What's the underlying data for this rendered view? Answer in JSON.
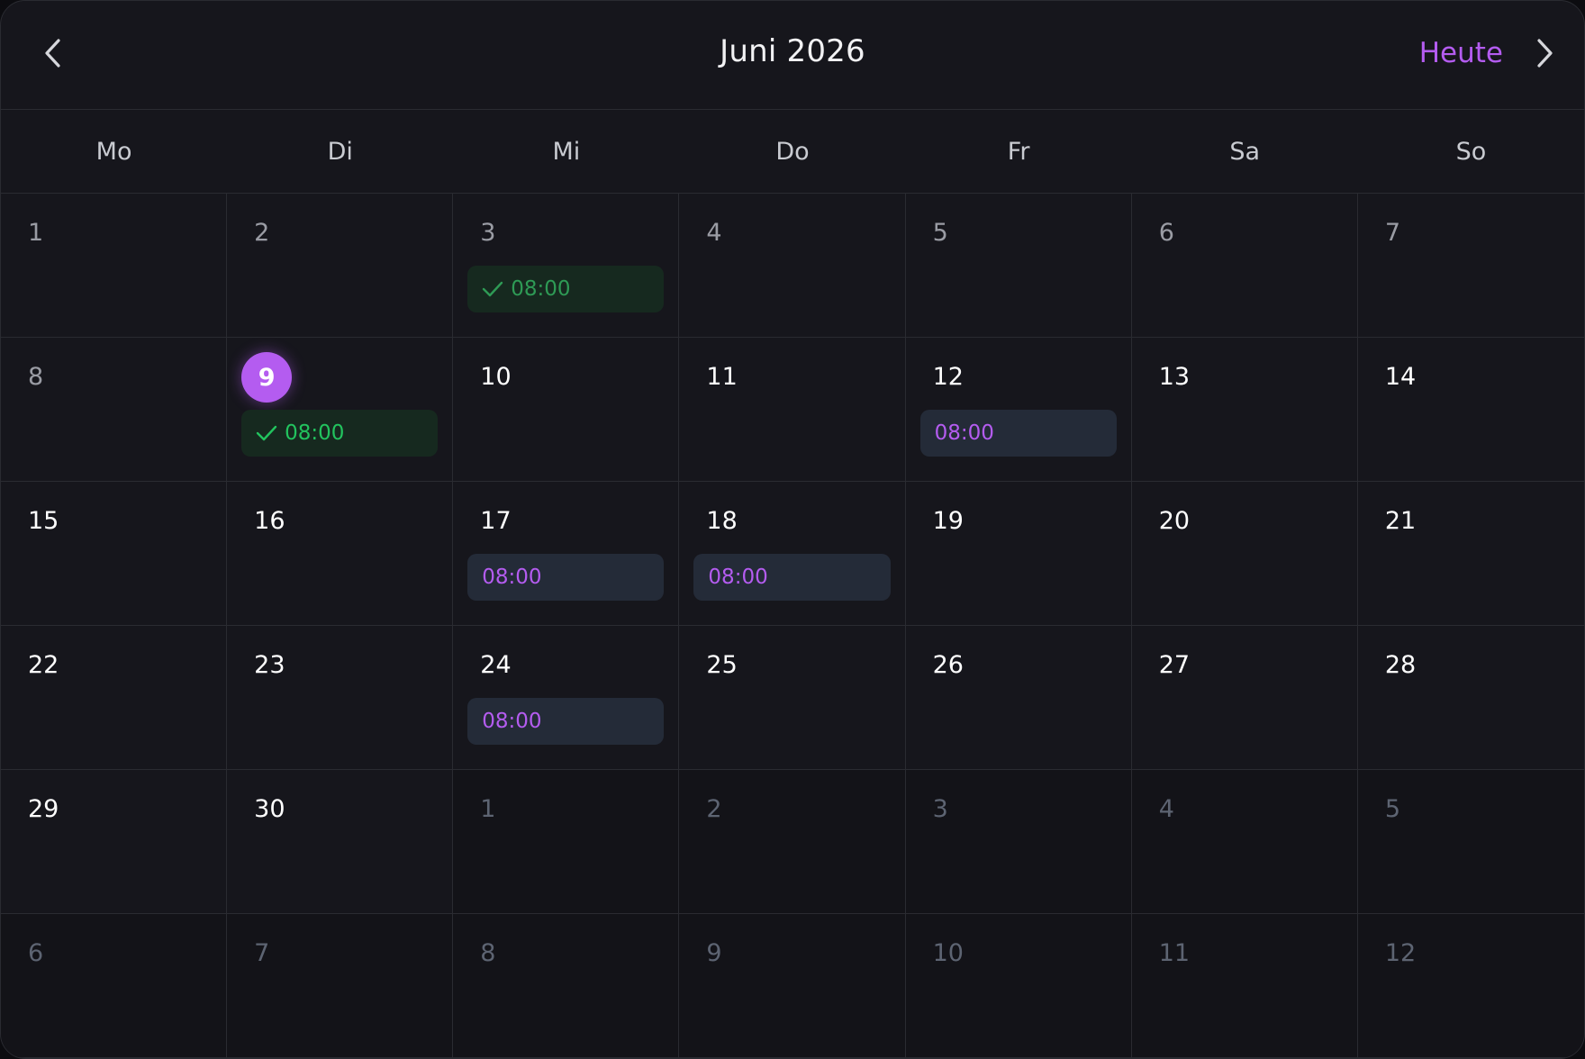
{
  "header": {
    "title": "Juni 2026",
    "today_label": "Heute",
    "prev_icon": "chevron-left-icon",
    "next_icon": "chevron-right-icon"
  },
  "weekdays": [
    "Mo",
    "Di",
    "Mi",
    "Do",
    "Fr",
    "Sa",
    "So"
  ],
  "colors": {
    "accent": "#b45cf0",
    "done": "#22c35e",
    "background": "#16161c"
  },
  "days": [
    {
      "day": "1",
      "state": "past"
    },
    {
      "day": "2",
      "state": "past"
    },
    {
      "day": "3",
      "state": "past",
      "event": {
        "time": "08:00",
        "status": "done"
      }
    },
    {
      "day": "4",
      "state": "past"
    },
    {
      "day": "5",
      "state": "past"
    },
    {
      "day": "6",
      "state": "past"
    },
    {
      "day": "7",
      "state": "past"
    },
    {
      "day": "8",
      "state": "past"
    },
    {
      "day": "9",
      "state": "today",
      "event": {
        "time": "08:00",
        "status": "done"
      }
    },
    {
      "day": "10",
      "state": "future"
    },
    {
      "day": "11",
      "state": "future"
    },
    {
      "day": "12",
      "state": "future",
      "event": {
        "time": "08:00",
        "status": "scheduled"
      }
    },
    {
      "day": "13",
      "state": "future"
    },
    {
      "day": "14",
      "state": "future"
    },
    {
      "day": "15",
      "state": "future"
    },
    {
      "day": "16",
      "state": "future"
    },
    {
      "day": "17",
      "state": "future",
      "event": {
        "time": "08:00",
        "status": "scheduled"
      }
    },
    {
      "day": "18",
      "state": "future",
      "event": {
        "time": "08:00",
        "status": "scheduled"
      }
    },
    {
      "day": "19",
      "state": "future"
    },
    {
      "day": "20",
      "state": "future"
    },
    {
      "day": "21",
      "state": "future"
    },
    {
      "day": "22",
      "state": "future"
    },
    {
      "day": "23",
      "state": "future"
    },
    {
      "day": "24",
      "state": "future",
      "event": {
        "time": "08:00",
        "status": "scheduled"
      }
    },
    {
      "day": "25",
      "state": "future"
    },
    {
      "day": "26",
      "state": "future"
    },
    {
      "day": "27",
      "state": "future"
    },
    {
      "day": "28",
      "state": "future"
    },
    {
      "day": "29",
      "state": "future"
    },
    {
      "day": "30",
      "state": "future"
    },
    {
      "day": "1",
      "state": "outside"
    },
    {
      "day": "2",
      "state": "outside"
    },
    {
      "day": "3",
      "state": "outside"
    },
    {
      "day": "4",
      "state": "outside"
    },
    {
      "day": "5",
      "state": "outside"
    },
    {
      "day": "6",
      "state": "outside"
    },
    {
      "day": "7",
      "state": "outside"
    },
    {
      "day": "8",
      "state": "outside"
    },
    {
      "day": "9",
      "state": "outside"
    },
    {
      "day": "10",
      "state": "outside"
    },
    {
      "day": "11",
      "state": "outside"
    },
    {
      "day": "12",
      "state": "outside"
    }
  ]
}
